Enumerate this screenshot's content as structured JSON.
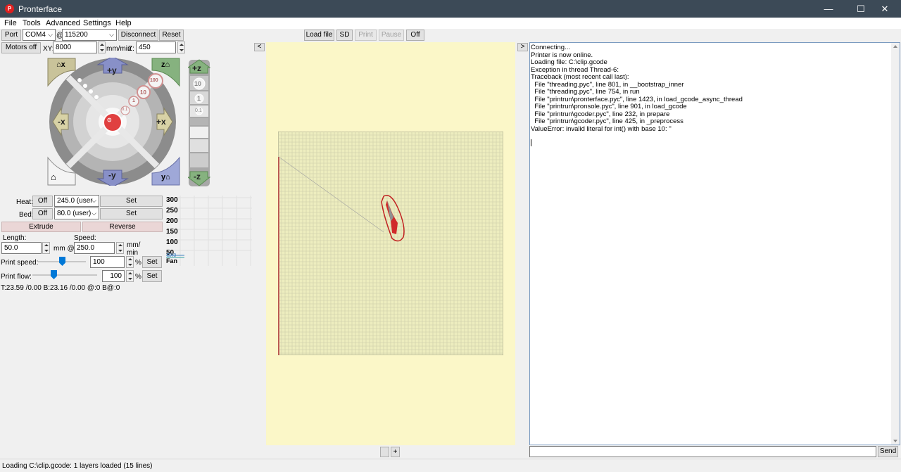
{
  "window": {
    "title": "Pronterface",
    "app_icon": "P",
    "minimize": "—",
    "maximize": "☐",
    "close": "✕"
  },
  "menu": [
    "File",
    "Tools",
    "Advanced",
    "Settings",
    "Help"
  ],
  "connection": {
    "port_label": "Port",
    "port_value": "COM4",
    "at": "@",
    "baud_value": "115200",
    "disconnect": "Disconnect",
    "reset": "Reset"
  },
  "file_controls": {
    "load_file": "Load file",
    "sd": "SD",
    "print": "Print",
    "pause": "Pause",
    "off": "Off"
  },
  "motors": {
    "motors_off": "Motors off",
    "xy_label": "XY:",
    "xy_value": "8000",
    "unit": "mm/min",
    "z_label": "Z:",
    "z_value": "450"
  },
  "jog": {
    "home_x": "x",
    "home_z": "z",
    "home_all": "",
    "home_y": "y",
    "plus_y": "+y",
    "minus_y": "-y",
    "minus_x": "-x",
    "plus_x": "+x",
    "step_100": "100",
    "step_10": "10",
    "step_1": "1",
    "step_01": "0.1",
    "plus_z": "+z",
    "minus_z": "-z",
    "z_10": "10",
    "z_1": "1",
    "z_01": "0.1"
  },
  "temps": {
    "heat_label": "Heat:",
    "heat_off": "Off",
    "heat_value": "245.0 (user",
    "bed_label": "Bed:",
    "bed_off": "Off",
    "bed_value": "80.0 (user)",
    "set": "Set"
  },
  "extrusion": {
    "extrude": "Extrude",
    "reverse": "Reverse",
    "length_label": "Length:",
    "length_value": "50.0",
    "mm_at": "mm @",
    "speed_label": "Speed:",
    "speed_value": "250.0",
    "speed_unit_1": "mm/",
    "speed_unit_2": "min"
  },
  "print_speed": {
    "label": "Print speed:",
    "value": "100",
    "pct": "%",
    "set": "Set",
    "level": 0.5
  },
  "print_flow": {
    "label": "Print flow:",
    "value": "100",
    "pct": "%",
    "set": "Set",
    "level": 0.5
  },
  "temp_readout": "T:23.59 /0.00 B:23.16 /0.00 @:0 B@:0",
  "graph_ticks": [
    "300",
    "250",
    "200",
    "150",
    "100",
    "50"
  ],
  "graph_fan": "Fan",
  "graph_ex": "EX0",
  "collapse_left": "<",
  "collapse_right": ">",
  "zoom_minus": "",
  "zoom_plus": "+",
  "console": {
    "lines": [
      "Connecting...",
      "Printer is now online.",
      "Loading file: C:\\clip.gcode",
      "Exception in thread Thread-6:",
      "Traceback (most recent call last):",
      "  File \"threading.pyc\", line 801, in __bootstrap_inner",
      "  File \"threading.pyc\", line 754, in run",
      "  File \"printrun\\pronterface.pyc\", line 1423, in load_gcode_async_thread",
      "  File \"printrun\\pronsole.pyc\", line 901, in load_gcode",
      "  File \"printrun\\gcoder.pyc\", line 232, in prepare",
      "  File \"printrun\\gcoder.pyc\", line 425, in _preprocess",
      "ValueError: invalid literal for int() with base 10: ''"
    ],
    "command_value": "",
    "send": "Send"
  },
  "status": "Loading C:\\clip.gcode: 1 layers loaded (15 lines)",
  "colors": {
    "bed": "#ededbf",
    "canvas_bg": "#fbf7c8",
    "accent": "#0078d7",
    "part": "#cc2020"
  }
}
